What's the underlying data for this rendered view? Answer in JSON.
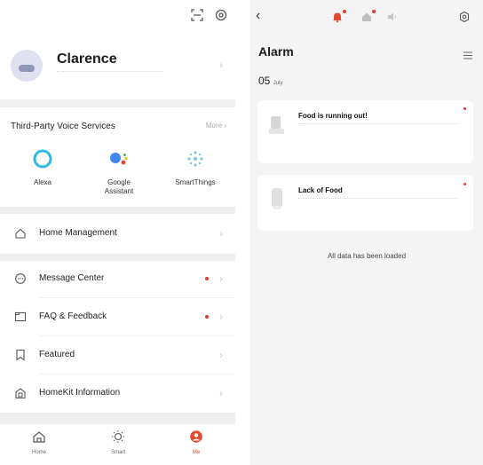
{
  "left": {
    "top_icons": [
      "scan-icon",
      "settings-icon"
    ],
    "profile": {
      "name": "Clarence"
    },
    "voice": {
      "title": "Third-Party Voice Services",
      "more": "More",
      "services": [
        {
          "label": "Alexa",
          "icon": "alexa-icon"
        },
        {
          "label": "Google\nAssistant",
          "icon": "google-assistant-icon"
        },
        {
          "label": "SmartThings",
          "icon": "smartthings-icon"
        }
      ]
    },
    "menu": [
      {
        "label": "Home Management",
        "icon": "home-icon"
      },
      {
        "label": "Message Center",
        "icon": "message-icon"
      },
      {
        "label": "FAQ & Feedback",
        "icon": "faq-icon"
      },
      {
        "label": "Featured",
        "icon": "bookmark-icon"
      },
      {
        "label": "HomeKit Information",
        "icon": "homekit-icon"
      }
    ],
    "tabs": [
      {
        "label": "Home",
        "icon": "home-tab-icon"
      },
      {
        "label": "Smart",
        "icon": "smart-tab-icon"
      },
      {
        "label": "Me",
        "icon": "me-tab-icon"
      }
    ],
    "colors": {
      "accent": "#e64a2e",
      "badge": "#e53935"
    }
  },
  "right": {
    "title": "Alarm",
    "date_day": "05",
    "date_month": "July",
    "cards": [
      {
        "title": "Food is running out!"
      },
      {
        "title": "Lack of Food"
      }
    ],
    "loaded_text": "All data has been loaded"
  }
}
